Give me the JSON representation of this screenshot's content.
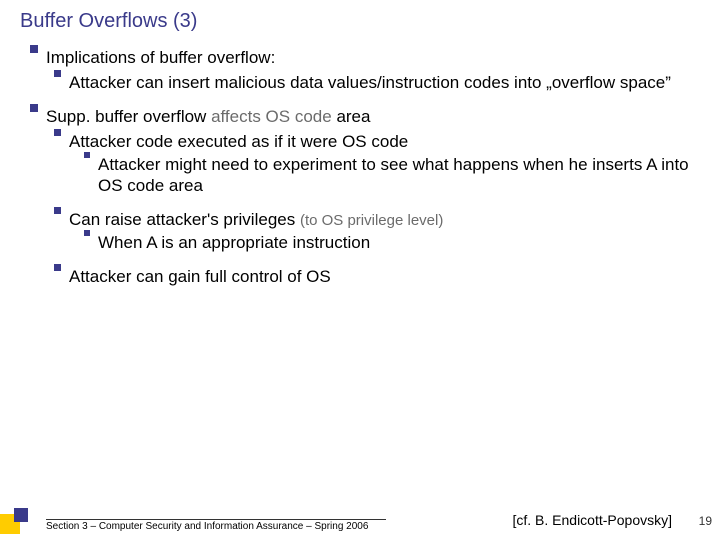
{
  "title": "Buffer Overflows (3)",
  "b1": {
    "head": "Implications of buffer overflow:",
    "sub1": "Attacker can insert malicious data values/instruction codes into „overflow space”"
  },
  "b2": {
    "head_a": "Supp. buffer overflow ",
    "head_b": "affects OS code",
    "head_c": " area",
    "s1": "Attacker code executed as if it were OS code",
    "s1a": "Attacker might need to experiment to see what happens when he inserts A into OS code area",
    "s2_a": "Can raise attacker's privileges ",
    "s2_b": "(to OS privilege level)",
    "s2a": "When A is an appropriate instruction",
    "s3": "Attacker can gain full control of OS"
  },
  "footer": "Section 3 – Computer Security and Information Assurance – Spring 2006",
  "cite": "[cf. B. Endicott-Popovsky]",
  "page": "19"
}
